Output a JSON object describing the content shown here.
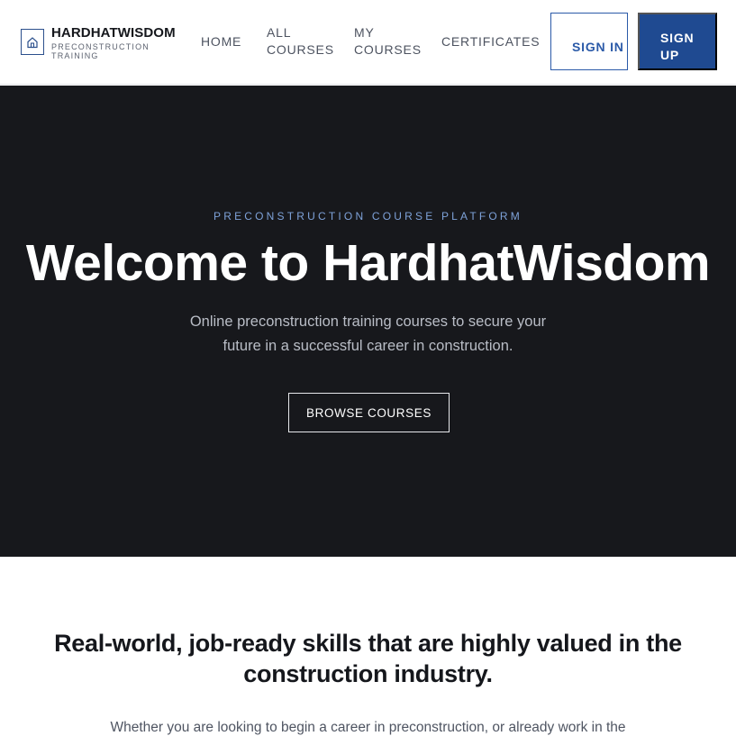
{
  "header": {
    "brand_name": "HARDHATWISDOM",
    "brand_tagline": "PRECONSTRUCTION TRAINING",
    "nav": {
      "home": "HOME",
      "all_courses": "ALL COURSES",
      "my_courses": "MY COURSES",
      "certificates": "CERTIFICATES"
    },
    "sign_in": "SIGN IN",
    "sign_up": "SIGN UP"
  },
  "hero": {
    "eyebrow": "PRECONSTRUCTION COURSE PLATFORM",
    "title": "Welcome to HardhatWisdom",
    "subtitle": "Online preconstruction training courses to secure your future in a successful career in construction.",
    "cta": "BROWSE COURSES"
  },
  "skills": {
    "title": "Real-world, job-ready skills that are highly valued in the construction industry.",
    "body": "Whether you are looking to begin a career in preconstruction, or already work in the"
  },
  "colors": {
    "accent": "#1f4a91",
    "hero_background": "#17181c",
    "eyebrow": "#7ea2d9"
  },
  "icons": {
    "logo": "house-icon"
  }
}
